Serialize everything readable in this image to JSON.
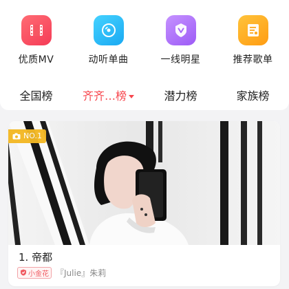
{
  "quick_actions": [
    {
      "label": "优质MV",
      "icon": "film-icon"
    },
    {
      "label": "动听单曲",
      "icon": "disc-icon"
    },
    {
      "label": "一线明星",
      "icon": "star-badge-icon"
    },
    {
      "label": "推荐歌单",
      "icon": "playlist-icon"
    }
  ],
  "tabs": [
    {
      "label": "全国榜"
    },
    {
      "label": "齐齐…榜"
    },
    {
      "label": "潜力榜"
    },
    {
      "label": "家族榜"
    }
  ],
  "card": {
    "badge": "NO.1",
    "title": "1. 帝都",
    "tag": "小金花",
    "song_info": "『Julie』朱莉"
  },
  "colors": {
    "active_tab": "#f7464d",
    "badge": "#f3b824"
  }
}
